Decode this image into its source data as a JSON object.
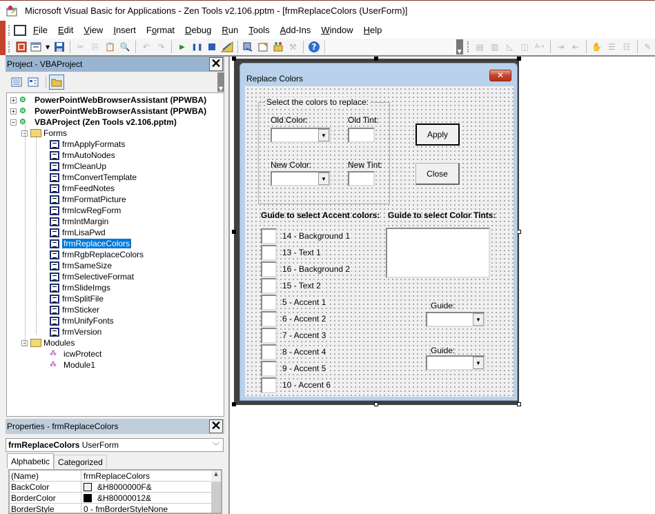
{
  "window": {
    "title": "Microsoft Visual Basic for Applications - Zen Tools v2.106.pptm - [frmReplaceColors (UserForm)]"
  },
  "menubar": {
    "items": [
      {
        "label": "File",
        "u": "F",
        "rest": "ile"
      },
      {
        "label": "Edit",
        "u": "E",
        "rest": "dit"
      },
      {
        "label": "View",
        "u": "V",
        "rest": "iew"
      },
      {
        "label": "Insert",
        "u": "I",
        "rest": "nsert"
      },
      {
        "label": "Format",
        "pre": "F",
        "u": "o",
        "rest": "rmat"
      },
      {
        "label": "Debug",
        "u": "D",
        "rest": "ebug"
      },
      {
        "label": "Run",
        "u": "R",
        "rest": "un"
      },
      {
        "label": "Tools",
        "u": "T",
        "rest": "ools"
      },
      {
        "label": "Add-Ins",
        "u": "A",
        "rest": "dd-Ins"
      },
      {
        "label": "Window",
        "u": "W",
        "rest": "indow"
      },
      {
        "label": "Help",
        "u": "H",
        "rest": "elp"
      }
    ]
  },
  "toolbar": {
    "buttons": [
      "view-powerpoint",
      "insert-userform",
      "save",
      "cut",
      "copy",
      "paste",
      "find",
      "undo",
      "redo",
      "run",
      "break",
      "reset",
      "design-mode",
      "project-explorer",
      "properties-window",
      "object-browser",
      "toolbox",
      "help"
    ],
    "edit_buttons": [
      "list-properties",
      "list-constants",
      "quick-info",
      "parameter-info",
      "complete-word",
      "indent",
      "outdent",
      "toggle-breakpoint",
      "comment-block",
      "uncomment-block",
      "bookmark"
    ]
  },
  "project_pane": {
    "title": "Project - VBAProject",
    "close_label": "✕",
    "tree": {
      "roots": [
        {
          "label": "PowerPointWebBrowserAssistant (PPWBA)",
          "expander": "+"
        },
        {
          "label": "PowerPointWebBrowserAssistant (PPWBA)",
          "expander": "+"
        },
        {
          "label": "VBAProject (Zen Tools v2.106.pptm)",
          "expander": "−"
        }
      ],
      "forms_folder": "Forms",
      "forms": [
        "frmApplyFormats",
        "frmAutoNodes",
        "frmCleanUp",
        "frmConvertTemplate",
        "frmFeedNotes",
        "frmFormatPicture",
        "frmIcwRegForm",
        "frmIntMargin",
        "frmLisaPwd",
        "frmReplaceColors",
        "frmRgbReplaceColors",
        "frmSameSize",
        "frmSelectiveFormat",
        "frmSlideImgs",
        "frmSplitFile",
        "frmSticker",
        "frmUnifyFonts",
        "frmVersion"
      ],
      "selected_form": "frmReplaceColors",
      "modules_folder": "Modules",
      "modules": [
        "icwProtect",
        "Module1"
      ]
    }
  },
  "properties_pane": {
    "title": "Properties - frmReplaceColors",
    "object_name": "frmReplaceColors",
    "object_type": "UserForm",
    "tabs": [
      "Alphabetic",
      "Categorized"
    ],
    "active_tab": "Alphabetic",
    "rows": [
      {
        "name": "(Name)",
        "value": "frmReplaceColors"
      },
      {
        "name": "BackColor",
        "value": "&H8000000F&",
        "swatch": "#f0f0f0"
      },
      {
        "name": "BorderColor",
        "value": "&H80000012&",
        "swatch": "#000000"
      },
      {
        "name": "BorderStyle",
        "value": "0 - fmBorderStyleNone"
      }
    ]
  },
  "userform": {
    "caption": "Replace Colors",
    "close_label": "✕",
    "frame_caption": "Select the colors to replace:",
    "old_color_label": "Old Color:",
    "old_tint_label": "Old Tint:",
    "new_color_label": "New Color:",
    "new_tint_label": "New Tint:",
    "old_color_value": "",
    "old_tint_value": "",
    "new_color_value": "",
    "new_tint_value": "",
    "apply_label": "Apply",
    "close_button_label": "Close",
    "accent_guide_header": "Guide to select Accent colors:",
    "tint_guide_header": "Guide to select Color Tints:",
    "accent_items": [
      "14 - Background 1",
      "13 - Text 1",
      "16 - Background 2",
      "15 - Text 2",
      "5 - Accent 1",
      "6 - Accent 2",
      "7 - Accent 3",
      "8 - Accent 4",
      "9 - Accent 5",
      "10 - Accent 6"
    ],
    "guide_label_1": "Guide:",
    "guide_label_2": "Guide:",
    "guide_value_1": "",
    "guide_value_2": ""
  }
}
